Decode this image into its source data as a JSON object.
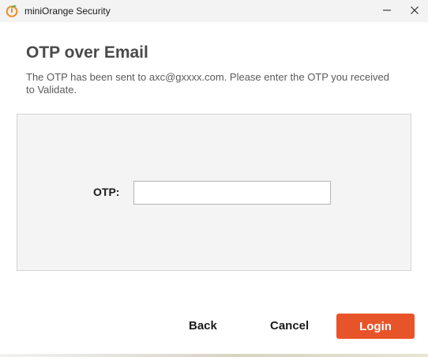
{
  "window": {
    "title": "miniOrange Security",
    "app_icon": "miniorange-logo-icon",
    "controls": {
      "minimize_icon": "minimize-icon",
      "close_icon": "close-icon"
    }
  },
  "main": {
    "heading": "OTP over Email",
    "description": "The OTP has been sent to axc@gxxxx.com. Please enter the OTP you received to Validate.",
    "otp_label": "OTP:",
    "otp_value": "",
    "otp_placeholder": ""
  },
  "actions": {
    "back_label": "Back",
    "cancel_label": "Cancel",
    "login_label": "Login"
  },
  "colors": {
    "accent": "#e8542a",
    "brand_orange": "#f08a24"
  }
}
